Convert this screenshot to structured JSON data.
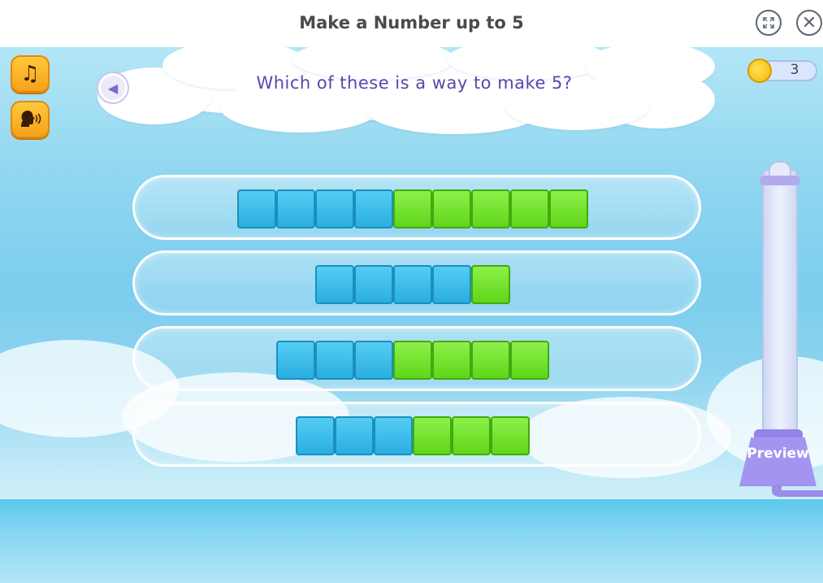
{
  "header": {
    "title": "Make a Number up to 5",
    "fullscreen_icon": "expand-icon",
    "close_label": "✕"
  },
  "sidebar": {
    "music_icon": "music-note-icon",
    "voice_icon": "speaking-head-icon"
  },
  "question": {
    "text": "Which of these is a way to make 5?",
    "audio_icon": "speaker-replay-icon"
  },
  "coins": {
    "count": "3",
    "icon": "coin-icon"
  },
  "answers": [
    {
      "blue": 4,
      "green": 5
    },
    {
      "blue": 4,
      "green": 1
    },
    {
      "blue": 3,
      "green": 4
    },
    {
      "blue": 3,
      "green": 3
    }
  ],
  "preview": {
    "label": "Preview"
  },
  "colors": {
    "blue_block": "#2aaee0",
    "green_block": "#5fd61a",
    "accent_purple": "#5b45b0",
    "button_orange": "#f7a21a"
  }
}
